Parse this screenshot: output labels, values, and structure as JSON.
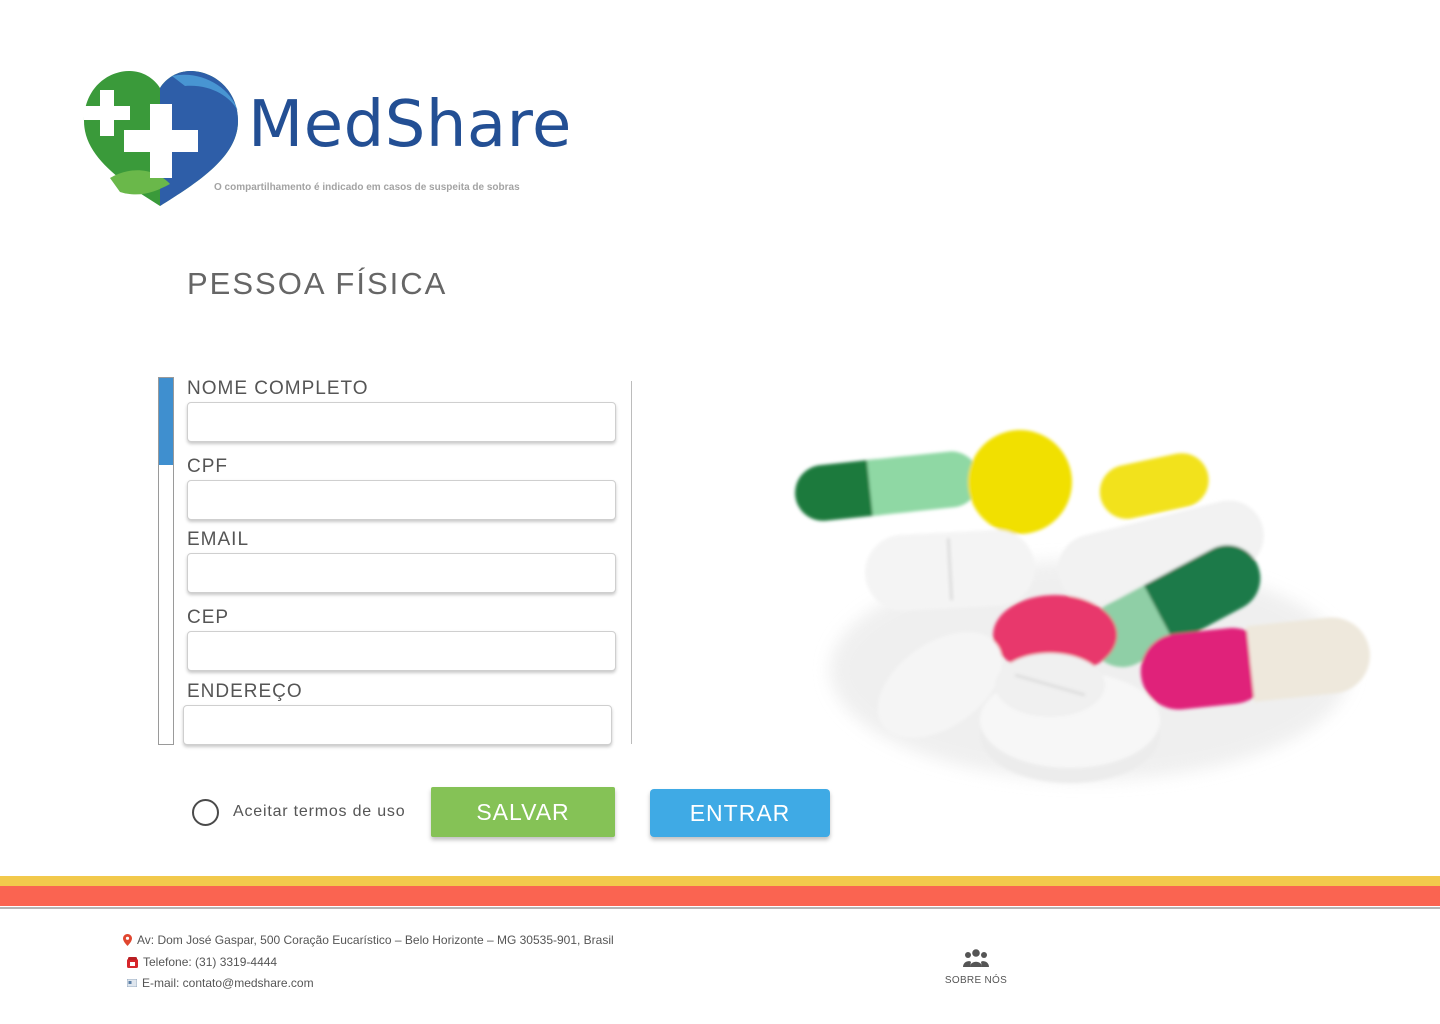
{
  "brand": {
    "name": "MedShare",
    "tagline": "O compartilhamento é indicado em casos de suspeita de sobras"
  },
  "page_title": "PESSOA FÍSICA",
  "form": {
    "fields": [
      {
        "label": "NOME COMPLETO",
        "value": "",
        "placeholder": ""
      },
      {
        "label": "CPF",
        "value": "",
        "placeholder": ""
      },
      {
        "label": "EMAIL",
        "value": "",
        "placeholder": ""
      },
      {
        "label": "CEP",
        "value": "",
        "placeholder": ""
      },
      {
        "label": "ENDEREÇO",
        "value": "",
        "placeholder": ""
      }
    ],
    "terms_label": "Aceitar termos de uso",
    "terms_checked": false,
    "save_label": "SALVAR",
    "enter_label": "ENTRAR",
    "scroll_position": 0.0
  },
  "footer": {
    "address": "Av: Dom José Gaspar, 500 Coração Eucarístico – Belo Horizonte – MG 30535-901, Brasil",
    "phone": "Telefone: (31) 3319-4444",
    "email": "E-mail: contato@medshare.com",
    "about_label": "SOBRE NÓS"
  },
  "colors": {
    "brand_blue": "#234f94",
    "brand_green": "#3a9a3a",
    "save_button": "#85c256",
    "enter_button": "#3faae5",
    "band_yellow": "#f2c94c",
    "band_red": "#fa6451",
    "scroll_accent": "#3f8fcf"
  },
  "icons": {
    "logo": "heart-cross-hands-logo",
    "address": "map-pin-icon",
    "phone": "telephone-icon",
    "email": "envelope-icon",
    "about": "users-group-icon"
  }
}
